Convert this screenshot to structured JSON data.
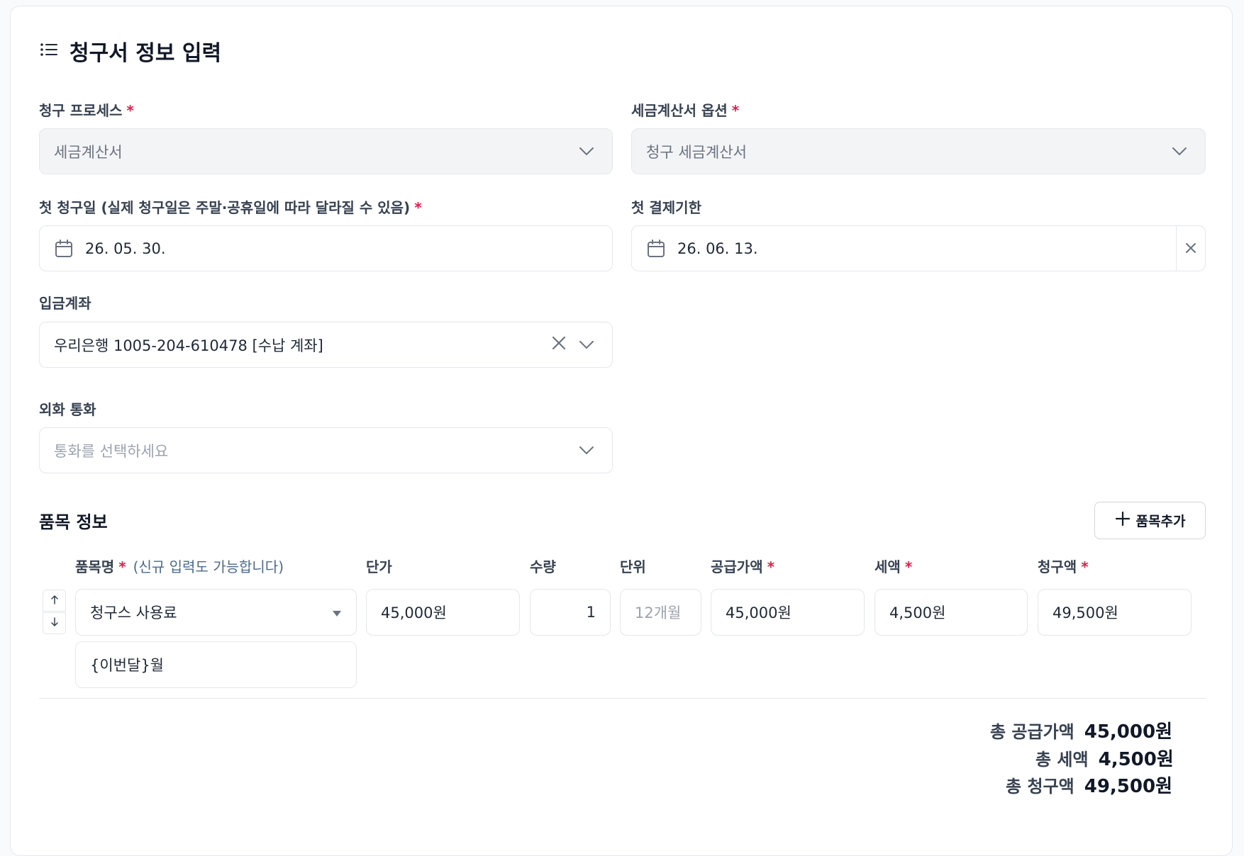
{
  "page_title": "청구서 정보 입력",
  "fields": {
    "billing_process": {
      "label": "청구 프로세스",
      "value": "세금계산서"
    },
    "tax_invoice_option": {
      "label": "세금계산서 옵션",
      "value": "청구 세금계산서"
    },
    "first_billing_date": {
      "label": "첫 청구일 (실제 청구일은 주말·공휴일에 따라 달라질 수 있음)",
      "value": "26. 05. 30."
    },
    "first_due_date": {
      "label": "첫 결제기한",
      "value": "26. 06. 13."
    },
    "deposit_account": {
      "label": "입금계좌",
      "value": "우리은행 1005-204-610478 [수납 계좌]"
    },
    "foreign_currency": {
      "label": "외화 통화",
      "placeholder": "통화를 선택하세요"
    }
  },
  "required_mark": "*",
  "items_section": {
    "title": "품목 정보",
    "add_button_label": "품목추가",
    "headers": {
      "name": "품목명",
      "name_hint": "(신규 입력도 가능합니다)",
      "unit_price": "단가",
      "quantity": "수량",
      "unit": "단위",
      "supply_amount": "공급가액",
      "tax": "세액",
      "billing_amount": "청구액"
    },
    "rows": [
      {
        "name": "청구스 사용료",
        "description": "{이번달}월",
        "unit_price": "45,000원",
        "quantity": "1",
        "unit_placeholder": "12개월",
        "supply_amount": "45,000원",
        "tax": "4,500원",
        "billing_amount": "49,500원"
      }
    ]
  },
  "totals": {
    "supply_label": "총 공급가액",
    "supply_value": "45,000원",
    "tax_label": "총 세액",
    "tax_value": "4,500원",
    "billing_label": "총 청구액",
    "billing_value": "49,500원"
  },
  "colors": {
    "required": "#e11d48",
    "hint": "#4b6a8a",
    "disabled_bg": "#f3f4f6"
  },
  "icons": [
    "list-icon",
    "chevron-down-icon",
    "calendar-icon",
    "close-icon",
    "plus-icon",
    "arrow-up-icon",
    "arrow-down-icon",
    "caret-down-icon"
  ]
}
